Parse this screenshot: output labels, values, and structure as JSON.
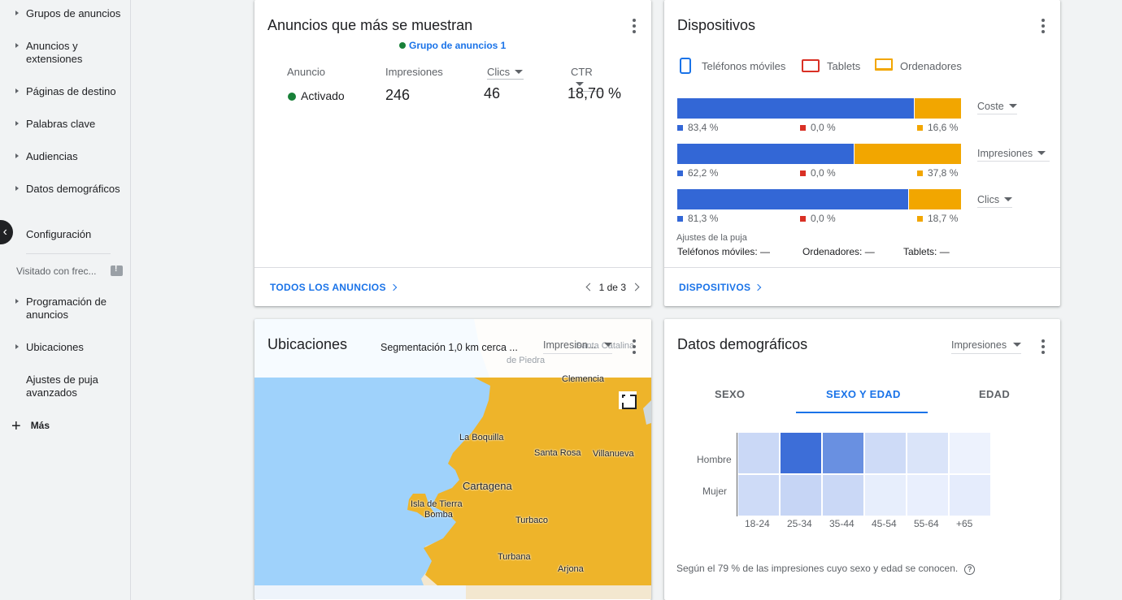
{
  "sidebar": {
    "items": [
      {
        "label": "Grupos de anuncios",
        "caret": true
      },
      {
        "label": "Anuncios y extensiones",
        "caret": true
      },
      {
        "label": "Páginas de destino",
        "caret": true
      },
      {
        "label": "Palabras clave",
        "caret": true
      },
      {
        "label": "Audiencias",
        "caret": true
      },
      {
        "label": "Datos demográficos",
        "caret": true
      },
      {
        "label": "Configuración",
        "caret": false
      }
    ],
    "visited_label": "Visitado con frec...",
    "visited_items": [
      {
        "label": "Programación de anuncios",
        "caret": true
      },
      {
        "label": "Ubicaciones",
        "caret": true
      },
      {
        "label": "Ajustes de puja avanzados",
        "caret": false
      }
    ],
    "more_label": "Más"
  },
  "top_ads": {
    "title": "Anuncios que más se muestran",
    "ad_group": "Grupo de anuncios 1",
    "columns": {
      "ad": "Anuncio",
      "impressions": "Impresiones",
      "clicks": "Clics",
      "ctr": "CTR"
    },
    "row": {
      "status": "Activado",
      "impressions": "246",
      "clicks": "46",
      "ctr": "18,70 %"
    },
    "footer_link": "TODOS LOS ANUNCIOS",
    "pager": "1 de 3"
  },
  "devices": {
    "title": "Dispositivos",
    "legend": {
      "mobile": "Teléfonos móviles",
      "tablet": "Tablets",
      "desktop": "Ordenadores"
    },
    "colors": {
      "mobile": "#3367d6",
      "tablet": "#d93025",
      "desktop": "#f2a600"
    },
    "rows": [
      {
        "metric": "Coste",
        "mobile": "83,4 %",
        "tablet": "0,0 %",
        "desktop": "16,6 %",
        "mobile_share": 0.834
      },
      {
        "metric": "Impresiones",
        "mobile": "62,2 %",
        "tablet": "0,0 %",
        "desktop": "37,8 %",
        "mobile_share": 0.622
      },
      {
        "metric": "Clics",
        "mobile": "81,3 %",
        "tablet": "0,0 %",
        "desktop": "18,7 %",
        "mobile_share": 0.813
      }
    ],
    "bid_title": "Ajustes de la puja",
    "bid": {
      "mobile": "Teléfonos móviles: —",
      "desktop": "Ordenadores: —",
      "tablet": "Tablets: —"
    },
    "footer_link": "DISPOSITIVOS"
  },
  "locations": {
    "title": "Ubicaciones",
    "segment": "Segmentación 1,0 km cerca ...",
    "metric": "Impresion...",
    "cities": {
      "san_pedro": "de Piedra",
      "santa_catalina": "Santa Catalina",
      "clemencia": "Clemencia",
      "la_boquilla": "La Boquilla",
      "santa_rosa": "Santa Rosa",
      "villanueva": "Villanueva",
      "cartagena": "Cartagena",
      "isla": "Isla de Tierra",
      "bomba": "Bomba",
      "turbaco": "Turbaco",
      "turbana": "Turbana",
      "arjona": "Arjona"
    }
  },
  "demographics": {
    "title": "Datos demográficos",
    "metric": "Impresiones",
    "tabs": [
      "SEXO",
      "SEXO Y EDAD",
      "EDAD"
    ],
    "active_tab": 1,
    "rows": [
      "Hombre",
      "Mujer"
    ],
    "age_groups": [
      "18-24",
      "25-34",
      "35-44",
      "45-54",
      "55-64",
      "+65"
    ],
    "heat": [
      [
        0.22,
        0.95,
        0.72,
        0.2,
        0.14,
        0.04
      ],
      [
        0.2,
        0.24,
        0.22,
        0.07,
        0.06,
        0.08
      ]
    ],
    "note": "Según el 79 % de las impresiones cuyo sexo y edad se conocen."
  }
}
